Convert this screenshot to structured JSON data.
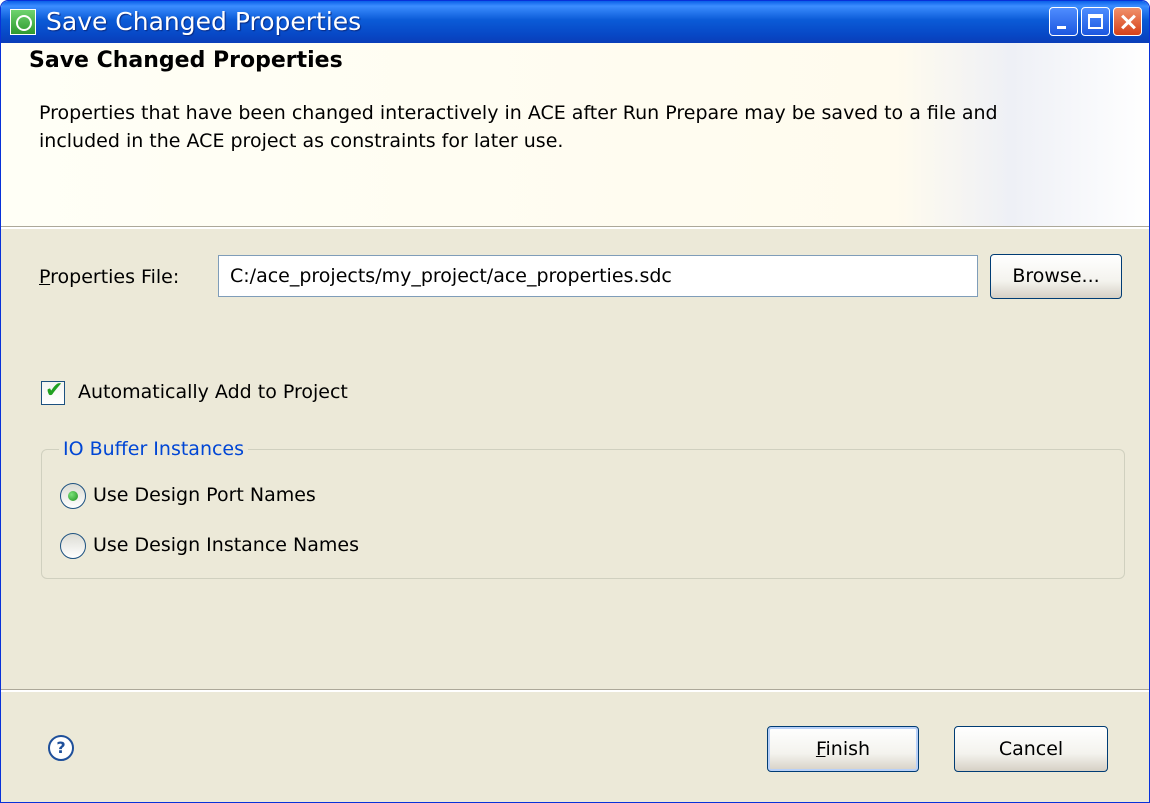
{
  "window": {
    "title": "Save Changed Properties"
  },
  "banner": {
    "title": "Save Changed Properties",
    "description": "Properties that have been changed interactively in ACE after Run Prepare may be saved to a file and included in the ACE project as constraints for later use."
  },
  "form": {
    "properties_file_label_mnemonic": "P",
    "properties_file_label_rest": "roperties File:",
    "properties_file_value": "C:/ace_projects/my_project/ace_properties.sdc",
    "browse_label": "Browse...",
    "auto_add_label": "Automatically Add to Project",
    "auto_add_checked": true
  },
  "io_group": {
    "legend": "IO Buffer Instances",
    "options": [
      {
        "label": "Use Design Port Names",
        "selected": true
      },
      {
        "label": "Use Design Instance Names",
        "selected": false
      }
    ]
  },
  "footer": {
    "help_icon": "?",
    "finish_mnemonic": "F",
    "finish_rest": "inish",
    "cancel_label": "Cancel"
  },
  "colors": {
    "titlebar": "#0b5bd7",
    "dialog_bg": "#ece9d8",
    "group_legend": "#0046d5",
    "check_mark": "#21a121"
  },
  "icons": {
    "app": "eclipse-app-icon",
    "window_controls": [
      "minimize-icon",
      "maximize-icon",
      "close-icon"
    ],
    "help": "help-icon"
  }
}
